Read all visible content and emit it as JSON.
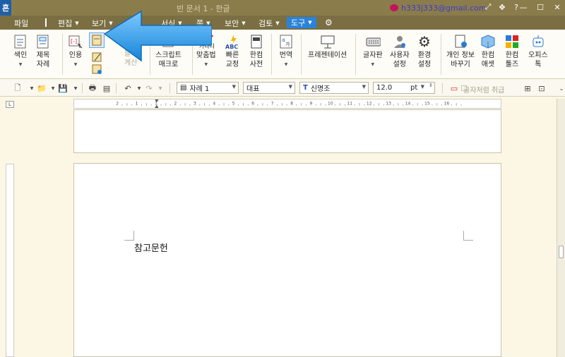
{
  "window": {
    "app_logo": "흔",
    "title": "빈 문서 1 - 한글",
    "account": "h333j333@gmail.com"
  },
  "menu": [
    {
      "label": "파일"
    },
    {
      "label": "편집"
    },
    {
      "label": "보기"
    },
    {
      "label": "서식"
    },
    {
      "label": "쪽"
    },
    {
      "label": "보안"
    },
    {
      "label": "검토"
    },
    {
      "label": "도구",
      "active": true
    }
  ],
  "ribbon": {
    "index": "색인",
    "title_list": "제목\n자례",
    "cite": "인용",
    "calc": "블록\n계산",
    "script_macro": "스크립트\n매크로",
    "spell": "맞춤법",
    "quick_correct": "빠른\n교정",
    "hancom_dict": "한컴\n사전",
    "translate": "번역",
    "presentation": "프레젠테이션",
    "keyboard": "글자판",
    "user_settings": "사용자\n설정",
    "env_settings": "환경\n설정",
    "change_info": "개인 정보\n바꾸기",
    "hancom_asset": "한컴\n애셋",
    "hancom_tools": "한컴\n툴즈",
    "office_tok": "오피스\n톡",
    "spell_icon_text": "가나다",
    "abc_icon_text": "ABC"
  },
  "toolbar": {
    "style": "자례 1",
    "font_rep": "대표",
    "font_name": "신명조",
    "font_size": "12.0",
    "size_unit": "pt",
    "frame_text": "글자처럼 취급"
  },
  "ruler": {
    "corner": "L",
    "numbers": [
      "2",
      "1",
      "1",
      "2",
      "3",
      "4",
      "5",
      "6",
      "7",
      "8",
      "9",
      "10",
      "11",
      "12",
      "13",
      "14",
      "15",
      "16"
    ]
  },
  "document": {
    "text": "참고문헌"
  },
  "colors": {
    "title_bg": "#8b7d4b",
    "menu_bg": "#7a6e42",
    "active_tab": "#2b83d9",
    "arrow": "#2b9be8"
  }
}
